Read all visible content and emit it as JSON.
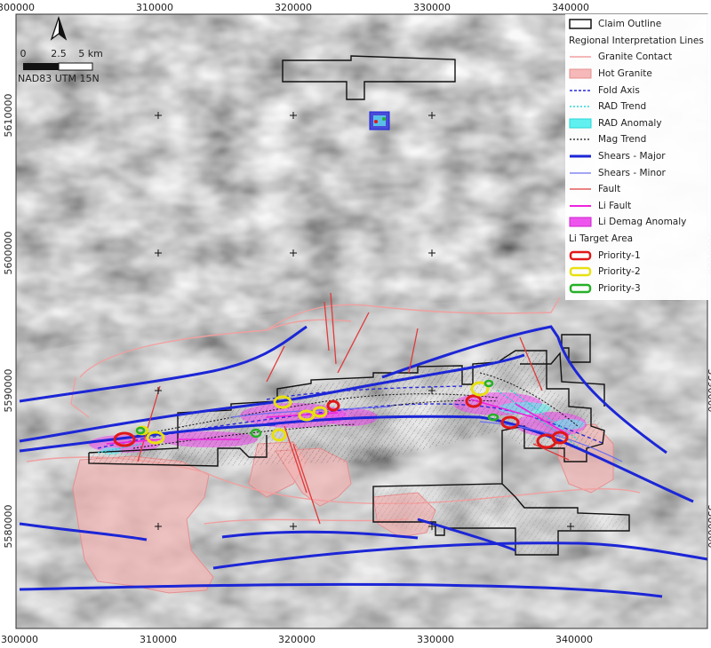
{
  "map": {
    "x_axis_labels": [
      "300000",
      "310000",
      "320000",
      "330000",
      "340000"
    ],
    "y_axis_labels": [
      "5610000",
      "5600000",
      "5590000",
      "5580000"
    ],
    "scale_labels": [
      "0",
      "2.5",
      "5 km"
    ],
    "datum": "NAD83 UTM 15N",
    "north_arrow_icon": "north-arrow-icon"
  },
  "legend": {
    "claim_outline": "Claim Outline",
    "regional_heading": "Regional Interpretation Lines",
    "items": [
      {
        "label": "Granite Contact",
        "color": "#f4a8a8"
      },
      {
        "label": "Hot Granite",
        "color": "#f6b8b8"
      },
      {
        "label": "Fold Axis",
        "color": "#2a2ad8"
      },
      {
        "label": "RAD Trend",
        "color": "#29d6d6"
      },
      {
        "label": "RAD Anomaly",
        "color": "#60f0f0"
      },
      {
        "label": "Mag Trend",
        "color": "#111111"
      },
      {
        "label": "Shears - Major",
        "color": "#1c26d6"
      },
      {
        "label": "Shears - Minor",
        "color": "#6b6ff0"
      },
      {
        "label": "Fault",
        "color": "#e03a3a"
      },
      {
        "label": "Li Fault",
        "color": "#ee22dd"
      },
      {
        "label": "Li Demag Anomaly",
        "color": "#ee55ee"
      }
    ],
    "target_heading": "Li Target Area",
    "targets": [
      {
        "label": "Priority-1",
        "color": "#e01818"
      },
      {
        "label": "Priority-2",
        "color": "#e8e010"
      },
      {
        "label": "Priority-3",
        "color": "#26b026"
      }
    ]
  }
}
